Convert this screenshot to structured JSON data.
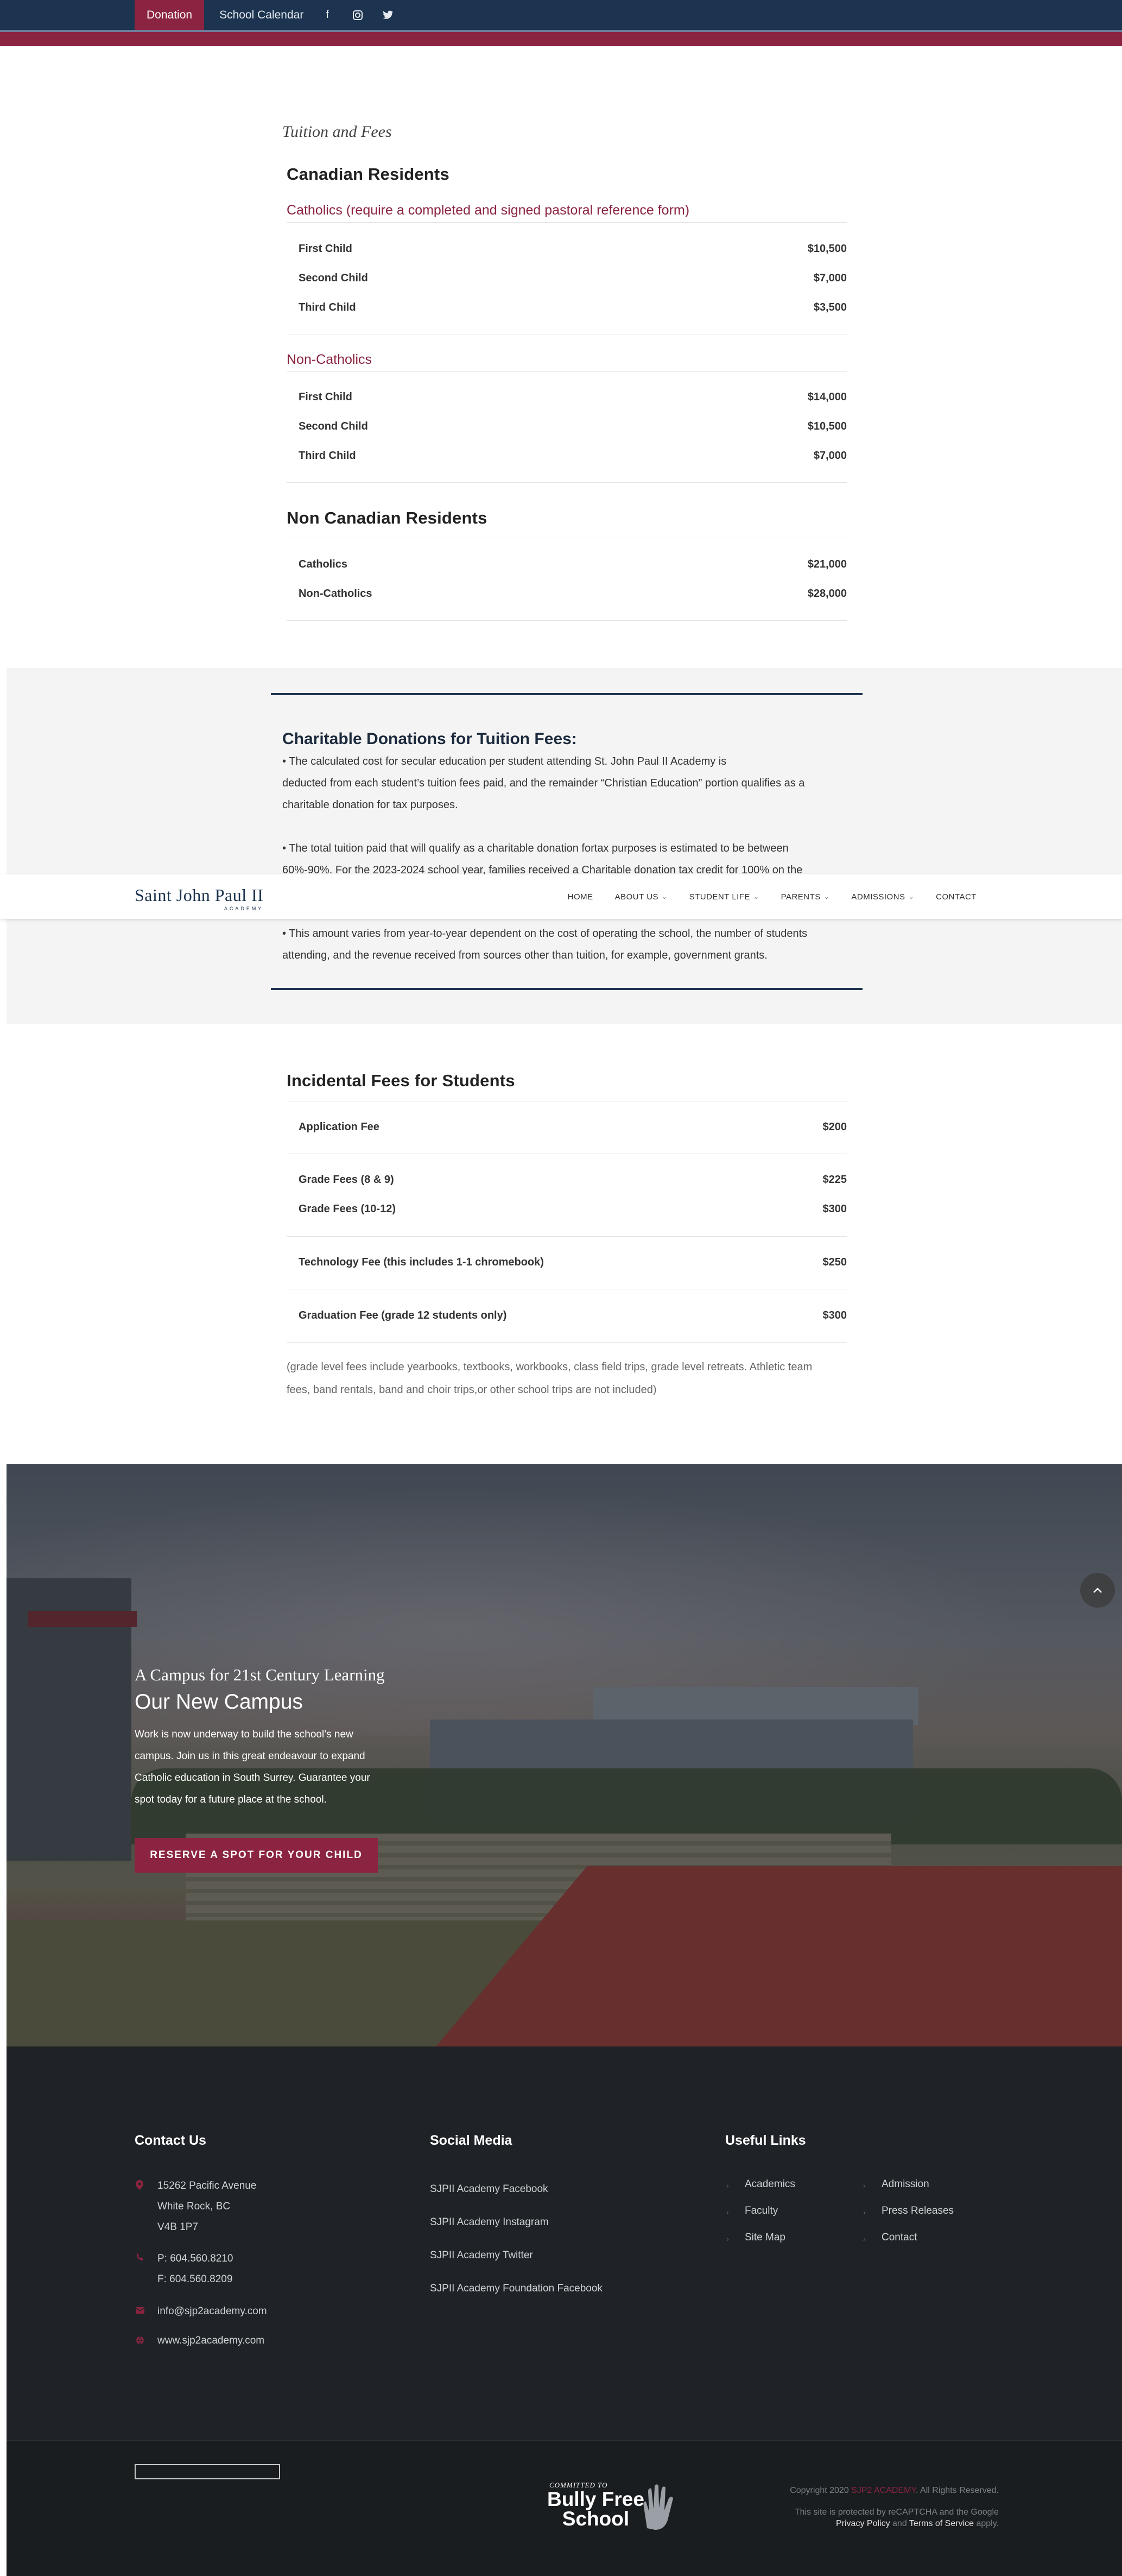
{
  "topbar": {
    "donation_label": "Donation",
    "calendar_label": "School Calendar",
    "facebook_icon": "f",
    "instagram_icon": "◎",
    "twitter_icon": "✦"
  },
  "tuition": {
    "script_title": "Tuition and Fees",
    "canadian": {
      "title": "Canadian Residents",
      "catholics": {
        "heading": "Catholics (require a completed and signed pastoral reference form)",
        "rows": [
          {
            "label": "First Child",
            "value": "$10,500"
          },
          {
            "label": "Second Child",
            "value": "$7,000"
          },
          {
            "label": "Third Child",
            "value": "$3,500"
          }
        ]
      },
      "non_catholics": {
        "heading": "Non-Catholics",
        "rows": [
          {
            "label": "First Child",
            "value": "$14,000"
          },
          {
            "label": "Second Child",
            "value": "$10,500"
          },
          {
            "label": "Third Child",
            "value": "$7,000"
          }
        ]
      }
    },
    "non_canadian": {
      "title": "Non Canadian Residents",
      "rows": [
        {
          "label": "Catholics",
          "value": "$21,000"
        },
        {
          "label": "Non-Catholics",
          "value": "$28,000"
        }
      ]
    }
  },
  "donations": {
    "title": "Charitable Donations for Tuition Fees:",
    "p1_line1": "• The calculated cost for secular education per student attending St. John Paul II Academy is",
    "p1_line2": "deducted from each student’s tuition fees paid, and the remainder “Christian Education” portion qualifies as a",
    "p1_line3": "charitable donation for tax purposes.",
    "p2_line1": "• The total tuition paid that will qualify as a charitable donation fortax purposes is estimated to be between",
    "p2_line2": "60%-90%. For the 2023-2024 school year, families received a Charitable donation tax credit for 100% on the",
    "p3_line1": "• This amount varies from year-to-year dependent on the cost of operating the school, the number of students",
    "p3_line2": "attending, and the revenue received from sources other than tuition, for example, government grants."
  },
  "nav": {
    "logo_main": "Saint John Paul II",
    "logo_sub": "ACADEMY",
    "items": [
      {
        "label": "HOME",
        "has_dropdown": false
      },
      {
        "label": "ABOUT US",
        "has_dropdown": true
      },
      {
        "label": "STUDENT LIFE",
        "has_dropdown": true
      },
      {
        "label": "PARENTS",
        "has_dropdown": true
      },
      {
        "label": "ADMISSIONS",
        "has_dropdown": true
      },
      {
        "label": "CONTACT",
        "has_dropdown": false
      }
    ]
  },
  "incidental": {
    "title": "Incidental Fees for Students",
    "rows": [
      {
        "label": "Application Fee",
        "value": "$200"
      },
      {
        "label": "Grade Fees (8 & 9)",
        "value": "$225"
      },
      {
        "label": "Grade Fees (10-12)",
        "value": "$300"
      },
      {
        "label": "Technology Fee (this includes 1-1 chromebook)",
        "value": "$250"
      },
      {
        "label": "Graduation Fee (grade 12 students only)",
        "value": "$300"
      }
    ],
    "note_line1": "(grade level fees include yearbooks, textbooks, workbooks, class field trips, grade level retreats. Athletic team",
    "note_line2": "fees, band rentals, band and choir trips,or other school trips are not included)"
  },
  "campus": {
    "script_title": "A Campus for 21st Century Learning",
    "title": "Our New Campus",
    "text_line1": "Work is now underway to build the school’s new",
    "text_line2": "campus. Join us in this great endeavour to expand",
    "text_line3": "Catholic education in South Surrey. Guarantee your",
    "text_line4": "spot today for a future place at the school.",
    "button_label": "RESERVE A SPOT FOR YOUR CHILD"
  },
  "footer": {
    "contact": {
      "title": "Contact Us",
      "address_line1": "15262 Pacific Avenue",
      "address_line2": "White Rock, BC",
      "address_line3": "V4B 1P7",
      "phone": "P: 604.560.8210",
      "fax": "F: 604.560.8209",
      "email": "info@sjp2academy.com",
      "website": "www.sjp2academy.com"
    },
    "social": {
      "title": "Social Media",
      "links": [
        "SJPII Academy Facebook",
        "SJPII Academy Instagram",
        "SJPII Academy Twitter",
        "SJPII Academy Foundation Facebook"
      ]
    },
    "useful": {
      "title": "Useful Links",
      "col1": [
        "Academics",
        "Faculty",
        "Site Map"
      ],
      "col2": [
        "Admission",
        "Press Releases",
        "Contact"
      ]
    },
    "bottom": {
      "bully_committed": "COMMITTED TO",
      "bully_line1": "Bully Free",
      "bully_line2": "School",
      "copyright_pre": "Copyright 2020",
      "copyright_brand": "SJP2 ACADEMY",
      "copyright_post": ". All Rights Reserved.",
      "recaptcha_line": "This site is protected by reCAPTCHA and the Google",
      "privacy": "Privacy Policy",
      "and": "and",
      "terms": "Terms of Service",
      "apply": "apply."
    }
  },
  "colors": {
    "navy": "#1c344f",
    "burgundy": "#8b2440",
    "footer_bg": "#1f2327"
  }
}
